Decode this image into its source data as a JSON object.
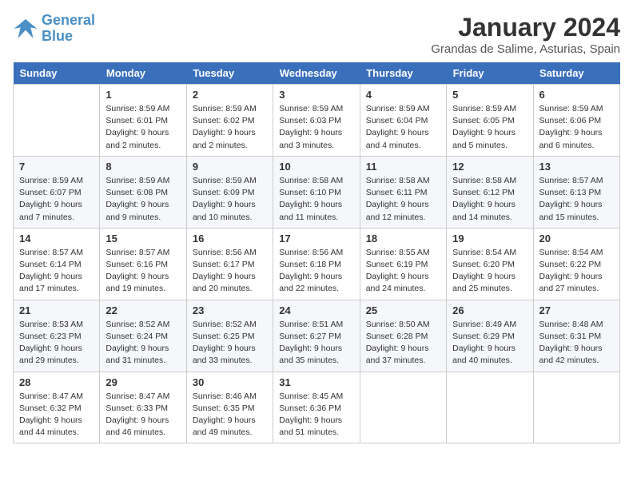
{
  "logo": {
    "line1": "General",
    "line2": "Blue"
  },
  "title": "January 2024",
  "location": "Grandas de Salime, Asturias, Spain",
  "days_of_week": [
    "Sunday",
    "Monday",
    "Tuesday",
    "Wednesday",
    "Thursday",
    "Friday",
    "Saturday"
  ],
  "weeks": [
    [
      {
        "day": "",
        "sunrise": "",
        "sunset": "",
        "daylight": ""
      },
      {
        "day": "1",
        "sunrise": "Sunrise: 8:59 AM",
        "sunset": "Sunset: 6:01 PM",
        "daylight": "Daylight: 9 hours and 2 minutes."
      },
      {
        "day": "2",
        "sunrise": "Sunrise: 8:59 AM",
        "sunset": "Sunset: 6:02 PM",
        "daylight": "Daylight: 9 hours and 2 minutes."
      },
      {
        "day": "3",
        "sunrise": "Sunrise: 8:59 AM",
        "sunset": "Sunset: 6:03 PM",
        "daylight": "Daylight: 9 hours and 3 minutes."
      },
      {
        "day": "4",
        "sunrise": "Sunrise: 8:59 AM",
        "sunset": "Sunset: 6:04 PM",
        "daylight": "Daylight: 9 hours and 4 minutes."
      },
      {
        "day": "5",
        "sunrise": "Sunrise: 8:59 AM",
        "sunset": "Sunset: 6:05 PM",
        "daylight": "Daylight: 9 hours and 5 minutes."
      },
      {
        "day": "6",
        "sunrise": "Sunrise: 8:59 AM",
        "sunset": "Sunset: 6:06 PM",
        "daylight": "Daylight: 9 hours and 6 minutes."
      }
    ],
    [
      {
        "day": "7",
        "sunrise": "Sunrise: 8:59 AM",
        "sunset": "Sunset: 6:07 PM",
        "daylight": "Daylight: 9 hours and 7 minutes."
      },
      {
        "day": "8",
        "sunrise": "Sunrise: 8:59 AM",
        "sunset": "Sunset: 6:08 PM",
        "daylight": "Daylight: 9 hours and 9 minutes."
      },
      {
        "day": "9",
        "sunrise": "Sunrise: 8:59 AM",
        "sunset": "Sunset: 6:09 PM",
        "daylight": "Daylight: 9 hours and 10 minutes."
      },
      {
        "day": "10",
        "sunrise": "Sunrise: 8:58 AM",
        "sunset": "Sunset: 6:10 PM",
        "daylight": "Daylight: 9 hours and 11 minutes."
      },
      {
        "day": "11",
        "sunrise": "Sunrise: 8:58 AM",
        "sunset": "Sunset: 6:11 PM",
        "daylight": "Daylight: 9 hours and 12 minutes."
      },
      {
        "day": "12",
        "sunrise": "Sunrise: 8:58 AM",
        "sunset": "Sunset: 6:12 PM",
        "daylight": "Daylight: 9 hours and 14 minutes."
      },
      {
        "day": "13",
        "sunrise": "Sunrise: 8:57 AM",
        "sunset": "Sunset: 6:13 PM",
        "daylight": "Daylight: 9 hours and 15 minutes."
      }
    ],
    [
      {
        "day": "14",
        "sunrise": "Sunrise: 8:57 AM",
        "sunset": "Sunset: 6:14 PM",
        "daylight": "Daylight: 9 hours and 17 minutes."
      },
      {
        "day": "15",
        "sunrise": "Sunrise: 8:57 AM",
        "sunset": "Sunset: 6:16 PM",
        "daylight": "Daylight: 9 hours and 19 minutes."
      },
      {
        "day": "16",
        "sunrise": "Sunrise: 8:56 AM",
        "sunset": "Sunset: 6:17 PM",
        "daylight": "Daylight: 9 hours and 20 minutes."
      },
      {
        "day": "17",
        "sunrise": "Sunrise: 8:56 AM",
        "sunset": "Sunset: 6:18 PM",
        "daylight": "Daylight: 9 hours and 22 minutes."
      },
      {
        "day": "18",
        "sunrise": "Sunrise: 8:55 AM",
        "sunset": "Sunset: 6:19 PM",
        "daylight": "Daylight: 9 hours and 24 minutes."
      },
      {
        "day": "19",
        "sunrise": "Sunrise: 8:54 AM",
        "sunset": "Sunset: 6:20 PM",
        "daylight": "Daylight: 9 hours and 25 minutes."
      },
      {
        "day": "20",
        "sunrise": "Sunrise: 8:54 AM",
        "sunset": "Sunset: 6:22 PM",
        "daylight": "Daylight: 9 hours and 27 minutes."
      }
    ],
    [
      {
        "day": "21",
        "sunrise": "Sunrise: 8:53 AM",
        "sunset": "Sunset: 6:23 PM",
        "daylight": "Daylight: 9 hours and 29 minutes."
      },
      {
        "day": "22",
        "sunrise": "Sunrise: 8:52 AM",
        "sunset": "Sunset: 6:24 PM",
        "daylight": "Daylight: 9 hours and 31 minutes."
      },
      {
        "day": "23",
        "sunrise": "Sunrise: 8:52 AM",
        "sunset": "Sunset: 6:25 PM",
        "daylight": "Daylight: 9 hours and 33 minutes."
      },
      {
        "day": "24",
        "sunrise": "Sunrise: 8:51 AM",
        "sunset": "Sunset: 6:27 PM",
        "daylight": "Daylight: 9 hours and 35 minutes."
      },
      {
        "day": "25",
        "sunrise": "Sunrise: 8:50 AM",
        "sunset": "Sunset: 6:28 PM",
        "daylight": "Daylight: 9 hours and 37 minutes."
      },
      {
        "day": "26",
        "sunrise": "Sunrise: 8:49 AM",
        "sunset": "Sunset: 6:29 PM",
        "daylight": "Daylight: 9 hours and 40 minutes."
      },
      {
        "day": "27",
        "sunrise": "Sunrise: 8:48 AM",
        "sunset": "Sunset: 6:31 PM",
        "daylight": "Daylight: 9 hours and 42 minutes."
      }
    ],
    [
      {
        "day": "28",
        "sunrise": "Sunrise: 8:47 AM",
        "sunset": "Sunset: 6:32 PM",
        "daylight": "Daylight: 9 hours and 44 minutes."
      },
      {
        "day": "29",
        "sunrise": "Sunrise: 8:47 AM",
        "sunset": "Sunset: 6:33 PM",
        "daylight": "Daylight: 9 hours and 46 minutes."
      },
      {
        "day": "30",
        "sunrise": "Sunrise: 8:46 AM",
        "sunset": "Sunset: 6:35 PM",
        "daylight": "Daylight: 9 hours and 49 minutes."
      },
      {
        "day": "31",
        "sunrise": "Sunrise: 8:45 AM",
        "sunset": "Sunset: 6:36 PM",
        "daylight": "Daylight: 9 hours and 51 minutes."
      },
      {
        "day": "",
        "sunrise": "",
        "sunset": "",
        "daylight": ""
      },
      {
        "day": "",
        "sunrise": "",
        "sunset": "",
        "daylight": ""
      },
      {
        "day": "",
        "sunrise": "",
        "sunset": "",
        "daylight": ""
      }
    ]
  ]
}
